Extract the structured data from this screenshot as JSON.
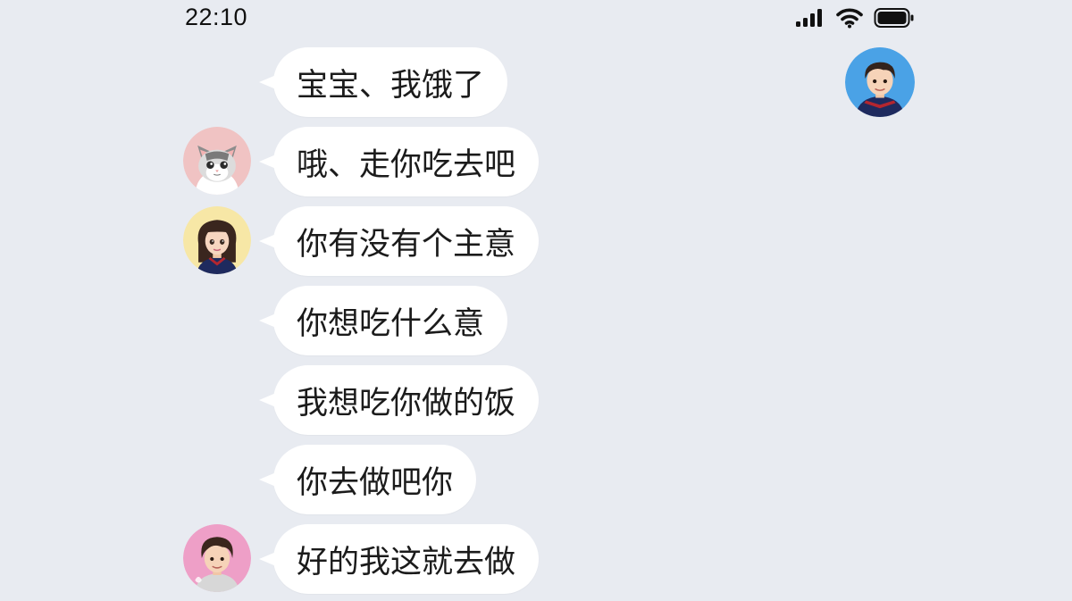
{
  "status_bar": {
    "time": "22:10",
    "icons": [
      "cellular-signal-icon",
      "wifi-icon",
      "battery-icon"
    ]
  },
  "colors": {
    "background": "#e8ebf1",
    "bubble": "#ffffff",
    "text": "#1b1b1b"
  },
  "messages": [
    {
      "text": "宝宝、我饿了",
      "avatar": "none"
    },
    {
      "text": "哦、走你吃去吧",
      "avatar": "cat-avatar"
    },
    {
      "text": "你有没有个主意",
      "avatar": "girl-avatar"
    },
    {
      "text": "你想吃什么意",
      "avatar": "none"
    },
    {
      "text": "我想吃你做的饭",
      "avatar": "none"
    },
    {
      "text": "你去做吧你",
      "avatar": "none"
    },
    {
      "text": "好的我这就去做",
      "avatar": "boy-pink-avatar"
    }
  ]
}
